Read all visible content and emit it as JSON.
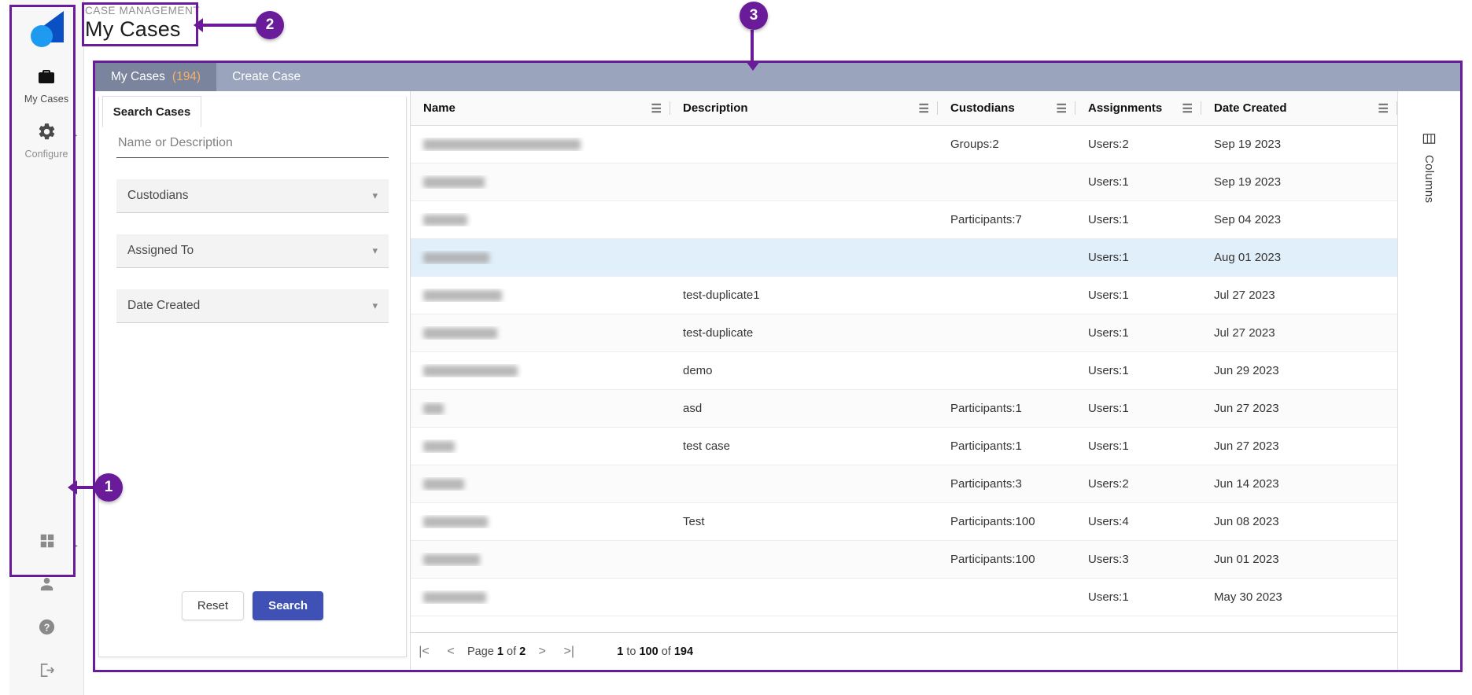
{
  "app": {
    "logo_name": "app-logo",
    "eyebrow": "CASE MANAGEMENT",
    "page_title": "My Cases"
  },
  "rail": {
    "items": [
      {
        "icon": "briefcase-icon",
        "glyph": "▮",
        "label": "My Cases",
        "active": true
      },
      {
        "icon": "gear-icon",
        "glyph": "⚙",
        "label": "Configure",
        "active": false
      }
    ],
    "bottom_items": [
      {
        "icon": "apps-grid-icon",
        "glyph": "▦",
        "label": ""
      },
      {
        "icon": "user-icon",
        "glyph": "●",
        "label": ""
      },
      {
        "icon": "help-icon",
        "glyph": "?",
        "label": ""
      },
      {
        "icon": "logout-icon",
        "glyph": "→",
        "label": ""
      }
    ]
  },
  "tabs": [
    {
      "label": "My Cases",
      "count": "(194)",
      "active": true
    },
    {
      "label": "Create Case",
      "count": "",
      "active": false
    }
  ],
  "search_panel": {
    "title": "Search Cases",
    "name_or_description": {
      "placeholder": "Name or Description",
      "value": ""
    },
    "selects": [
      {
        "label": "Custodians",
        "chevron": "chevron-down-icon"
      },
      {
        "label": "Assigned To",
        "chevron": "chevron-down-icon"
      },
      {
        "label": "Date Created",
        "chevron": "chevron-down-icon"
      }
    ],
    "reset_label": "Reset",
    "search_label": "Search"
  },
  "grid": {
    "columns": [
      {
        "key": "name",
        "label": "Name",
        "menu_icon": "column-menu-icon"
      },
      {
        "key": "description",
        "label": "Description",
        "menu_icon": "column-menu-icon"
      },
      {
        "key": "custodians",
        "label": "Custodians",
        "menu_icon": "column-menu-icon"
      },
      {
        "key": "assignments",
        "label": "Assignments",
        "menu_icon": "column-menu-icon"
      },
      {
        "key": "date_created",
        "label": "Date Created",
        "menu_icon": "column-menu-icon"
      }
    ],
    "rows": [
      {
        "name": "",
        "name_redacted": true,
        "name_width": 200,
        "description": "",
        "custodians": "Groups:2",
        "assignments": "Users:2",
        "date_created": "Sep 19 2023",
        "selected": false
      },
      {
        "name": "",
        "name_redacted": true,
        "name_width": 78,
        "description": "",
        "custodians": "",
        "assignments": "Users:1",
        "date_created": "Sep 19 2023",
        "selected": false
      },
      {
        "name": "",
        "name_redacted": true,
        "name_width": 56,
        "description": "",
        "custodians": "Participants:7",
        "assignments": "Users:1",
        "date_created": "Sep 04 2023",
        "selected": false
      },
      {
        "name": "",
        "name_redacted": true,
        "name_width": 84,
        "description": "",
        "custodians": "",
        "assignments": "Users:1",
        "date_created": "Aug 01 2023",
        "selected": true
      },
      {
        "name": "",
        "name_redacted": true,
        "name_width": 100,
        "description": "test-duplicate1",
        "custodians": "",
        "assignments": "Users:1",
        "date_created": "Jul 27 2023",
        "selected": false
      },
      {
        "name": "",
        "name_redacted": true,
        "name_width": 94,
        "description": "test-duplicate",
        "custodians": "",
        "assignments": "Users:1",
        "date_created": "Jul 27 2023",
        "selected": false
      },
      {
        "name": "",
        "name_redacted": true,
        "name_width": 120,
        "description": "demo",
        "custodians": "",
        "assignments": "Users:1",
        "date_created": "Jun 29 2023",
        "selected": false
      },
      {
        "name": "",
        "name_redacted": true,
        "name_width": 26,
        "description": "asd",
        "custodians": "Participants:1",
        "assignments": "Users:1",
        "date_created": "Jun 27 2023",
        "selected": false
      },
      {
        "name": "",
        "name_redacted": true,
        "name_width": 40,
        "description": "test case",
        "custodians": "Participants:1",
        "assignments": "Users:1",
        "date_created": "Jun 27 2023",
        "selected": false
      },
      {
        "name": "",
        "name_redacted": true,
        "name_width": 52,
        "description": "",
        "custodians": "Participants:3",
        "assignments": "Users:2",
        "date_created": "Jun 14 2023",
        "selected": false
      },
      {
        "name": "",
        "name_redacted": true,
        "name_width": 82,
        "description": "Test",
        "custodians": "Participants:100",
        "assignments": "Users:4",
        "date_created": "Jun 08 2023",
        "selected": false
      },
      {
        "name": "",
        "name_redacted": true,
        "name_width": 72,
        "description": "",
        "custodians": "Participants:100",
        "assignments": "Users:3",
        "date_created": "Jun 01 2023",
        "selected": false
      },
      {
        "name": "",
        "name_redacted": true,
        "name_width": 80,
        "description": "",
        "custodians": "",
        "assignments": "Users:1",
        "date_created": "May 30 2023",
        "selected": false
      }
    ]
  },
  "pagination": {
    "first_icon": "first-page-icon",
    "prev_icon": "previous-page-icon",
    "next_icon": "next-page-icon",
    "last_icon": "last-page-icon",
    "page_prefix": "Page",
    "page_current": "1",
    "page_of": "of",
    "page_total": "2",
    "range_from": "1",
    "range_to_word": "to",
    "range_to": "100",
    "range_of_word": "of",
    "range_total": "194"
  },
  "columns_tab": {
    "icon": "table-columns-icon",
    "label": "Columns"
  },
  "annotations": [
    {
      "id": "1",
      "label": "1"
    },
    {
      "id": "2",
      "label": "2"
    },
    {
      "id": "3",
      "label": "3"
    }
  ],
  "colors": {
    "annotation": "#6a1b9a",
    "tabbar": "#9aa5bd",
    "tab_active": "#7a849c",
    "tab_count": "#f3b068",
    "search_button": "#3f51b5",
    "row_selected": "#e1effa",
    "logo_blue": "#0b4fc4",
    "logo_cyan": "#1e9bf0"
  }
}
